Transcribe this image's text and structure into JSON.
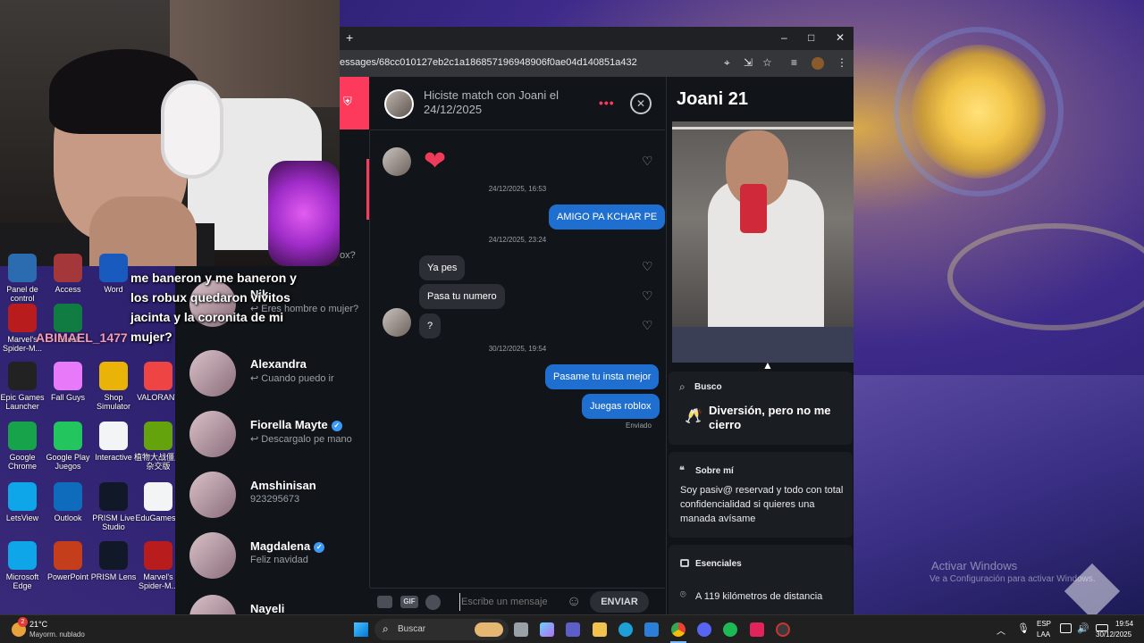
{
  "overlay": {
    "username": "ABIMAEL_1477",
    "chat_message": "me baneron y me baneron y los robux quedaron vivitos jacinta y la coronita de mi mujer?"
  },
  "desktop_icons": [
    {
      "label": "Panel de control",
      "color": "#2b6cb0"
    },
    {
      "label": "Access",
      "color": "#a4373a"
    },
    {
      "label": "Word",
      "color": "#185abd"
    },
    {
      "label": "Marvel's Spider-M...",
      "color": "#b91c1c"
    },
    {
      "label": "Excel",
      "color": "#107c41"
    },
    {
      "label": "Epic Games Launcher",
      "color": "#222222"
    },
    {
      "label": "Fall Guys",
      "color": "#e879f9"
    },
    {
      "label": "Shop Simulator",
      "color": "#eab308"
    },
    {
      "label": "VALORANT",
      "color": "#ef4444"
    },
    {
      "label": "Google Chrome",
      "color": "#16a34a"
    },
    {
      "label": "Google Play Juegos",
      "color": "#22c55e"
    },
    {
      "label": "Interactive",
      "color": "#f3f4f6"
    },
    {
      "label": "植物大战僵尸杂交版",
      "color": "#65a30d"
    },
    {
      "label": "LetsView",
      "color": "#0ea5e9"
    },
    {
      "label": "Outlook",
      "color": "#0f6cbd"
    },
    {
      "label": "PRISM Live Studio",
      "color": "#111827"
    },
    {
      "label": "EduGamesV",
      "color": "#f3f4f6"
    },
    {
      "label": "Microsoft Edge",
      "color": "#0ea5e9"
    },
    {
      "label": "PowerPoint",
      "color": "#c43e1c"
    },
    {
      "label": "PRISM Lens",
      "color": "#111827"
    },
    {
      "label": "Marvel's Spider-M...",
      "color": "#b91c1c"
    }
  ],
  "browser": {
    "new_tab": "+",
    "url": "essages/68cc010127eb2c1a186857196948906f0ae04d140851a432",
    "window_controls": [
      "–",
      "□",
      "✕"
    ]
  },
  "conversation_list": {
    "partial_text": "ox?",
    "items": [
      {
        "name": "Nik",
        "subtitle": "↩ Eres hombre o mujer?",
        "verified": false
      },
      {
        "name": "Alexandra",
        "subtitle": "↩ Cuando puedo ir",
        "verified": false
      },
      {
        "name": "Fiorella Mayte",
        "subtitle": "↩ Descargalo pe mano",
        "verified": true
      },
      {
        "name": "Amshinisan",
        "subtitle": "923295673",
        "verified": false
      },
      {
        "name": "Magdalena",
        "subtitle": "Feliz navidad",
        "verified": true
      },
      {
        "name": "Nayeli",
        "subtitle": "",
        "verified": false
      }
    ]
  },
  "chat": {
    "header": "Hiciste match con Joani el 24/12/2025",
    "more_label": "•••",
    "close_label": "✕",
    "timestamps": [
      "24/12/2025, 16:53",
      "24/12/2025, 23:24",
      "30/12/2025, 19:54"
    ],
    "messages": [
      {
        "direction": "in",
        "text": "❤"
      },
      {
        "direction": "out",
        "text": "AMIGO PA KCHAR PE"
      },
      {
        "direction": "in",
        "text": "Ya pes"
      },
      {
        "direction": "in",
        "text": "Pasa tu numero"
      },
      {
        "direction": "in",
        "text": "?"
      },
      {
        "direction": "out",
        "text": "Pasame tu insta mejor"
      },
      {
        "direction": "out",
        "text": "Juegas roblox"
      }
    ],
    "sent_status": "Enviado",
    "composer_placeholder": "Escribe un mensaje",
    "gif_label": "GIF",
    "send_label": "ENVIAR"
  },
  "profile": {
    "name_age": "Joani 21",
    "looking_for_label": "Busco",
    "looking_for_value": "Diversión, pero no me cierro",
    "about_label": "Sobre mí",
    "about_text": "Soy pasiv@ reservad y todo con total confidencialidad si quieres una manada avísame",
    "essentials_label": "Esenciales",
    "distance": "A 119 kilómetros de distancia"
  },
  "watermark": {
    "title": "Activar Windows",
    "subtitle": "Ve a Configuración para activar Windows."
  },
  "taskbar": {
    "weather_temp": "21°C",
    "weather_desc": "Mayorm. nublado",
    "weather_badge": "2",
    "search_placeholder": "Buscar",
    "lang_top": "ESP",
    "lang_bottom": "LAA",
    "time": "19:54",
    "date": "30/12/2025"
  },
  "colors": {
    "accent_brand": "#fd3a5c",
    "sent_bubble": "#1f6fd1",
    "verified": "#3b9af6"
  }
}
